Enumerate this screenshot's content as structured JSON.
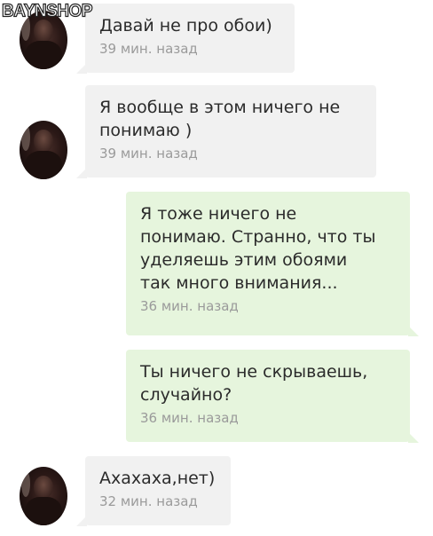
{
  "watermark": "BAYNSHOP",
  "messages": [
    {
      "direction": "incoming",
      "text": "Давай не про обои)",
      "time": "39 мин. назад"
    },
    {
      "direction": "incoming",
      "text": "Я вообще в этом ничего не\nпонимаю )",
      "time": "39 мин. назад"
    },
    {
      "direction": "outgoing",
      "text": "Я тоже ничего не\nпонимаю. Странно, что ты\nуделяешь этим обоями\nтак много внимания...",
      "time": "36 мин. назад"
    },
    {
      "direction": "outgoing",
      "text": "Ты ничего не скрываешь,\nслучайно?",
      "time": "36 мин. назад"
    },
    {
      "direction": "incoming",
      "text": "Ахахаха,нет)",
      "time": "32 мин. назад"
    }
  ],
  "colors": {
    "incoming_bubble": "#f1f1f1",
    "outgoing_bubble": "#e6f5dd",
    "text": "#2b2b2b",
    "timestamp": "#9a9a9a"
  }
}
